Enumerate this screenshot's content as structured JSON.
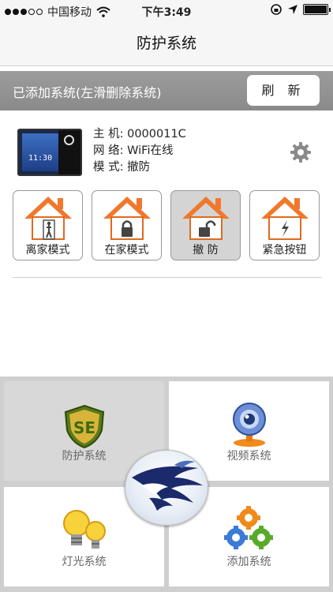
{
  "status_bar": {
    "carrier": "中国移动",
    "time": "下午3:49",
    "signal_bars": 3,
    "battery_level": 1.0
  },
  "navbar": {
    "title": "防护系统"
  },
  "systems_header": {
    "label": "已添加系统(左滑删除系统)",
    "refresh_label": "刷  新"
  },
  "device": {
    "thumb_time": "11:30",
    "host_label": "主  机: ",
    "host_value": "0000011C",
    "network_label": "网  络: ",
    "network_value": "WiFi在线",
    "mode_label": "模  式: ",
    "mode_value": "撤防"
  },
  "modes": [
    {
      "label": "离家模式",
      "icon": "person-door-icon",
      "active": false
    },
    {
      "label": "在家模式",
      "icon": "lock-closed-icon",
      "active": false
    },
    {
      "label": "撤  防",
      "icon": "lock-open-icon",
      "active": true
    },
    {
      "label": "紧急按钮",
      "icon": "lightning-icon",
      "active": false
    }
  ],
  "tiles": [
    {
      "label": "防护系统",
      "icon": "security-shield-icon"
    },
    {
      "label": "视频系统",
      "icon": "webcam-icon"
    },
    {
      "label": "灯光系统",
      "icon": "light-bulbs-icon"
    },
    {
      "label": "添加系统",
      "icon": "gears-icon"
    }
  ],
  "colors": {
    "header_gray": "#8a8a8a",
    "house_orange": "#f0782c",
    "active_mode_bg": "#d4d4d4"
  }
}
